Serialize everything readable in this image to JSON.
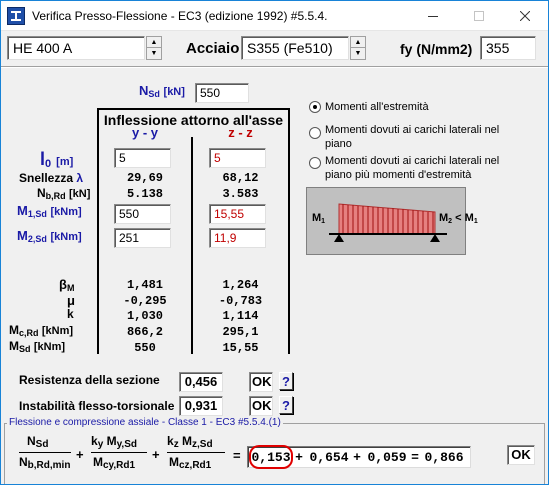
{
  "window": {
    "title": "Verifica Presso-Flessione - EC3 (edizione 1992) #5.5.4.",
    "icon": "app-i-beam-icon",
    "controls": [
      "minimize-icon",
      "maximize-icon",
      "close-icon"
    ]
  },
  "top": {
    "profile_value": "HE 400 A",
    "steel_label": "Acciaio",
    "steel_value": "S355 (Fe510)",
    "fy_label": "fy (N/mm2)",
    "fy_value": "355"
  },
  "nsd": {
    "label_main": "N",
    "label_sub": "Sd",
    "unit": "[kN]",
    "value": "550"
  },
  "table": {
    "header": "Inflessione attorno all'asse",
    "col_yy": "y - y",
    "col_zz": "z - z",
    "l0": {
      "label_main": "l",
      "label_sub": "0",
      "unit": "[m]",
      "yy": "5",
      "zz": "5"
    },
    "snellezza": {
      "label": "Snellezza",
      "symbol": "λ",
      "yy": "29,69",
      "zz": "68,12"
    },
    "nbrd": {
      "label_main": "N",
      "label_sub": "b,Rd",
      "unit": "[kN]",
      "yy": "5.138",
      "zz": "3.583"
    },
    "m1sd": {
      "label_main": "M",
      "label_sub": "1,Sd",
      "unit": "[kNm]",
      "yy": "550",
      "zz": "15,55"
    },
    "m2sd": {
      "label_main": "M",
      "label_sub": "2,Sd",
      "unit": "[kNm]",
      "yy": "251",
      "zz": "11,9"
    },
    "betam": {
      "label_main": "β",
      "label_sub": "M",
      "yy": "1,481",
      "zz": "1,264"
    },
    "mu": {
      "label": "μ",
      "yy": "-0,295",
      "zz": "-0,783"
    },
    "k": {
      "label": "k",
      "yy": "1,030",
      "zz": "1,114"
    },
    "mcrd": {
      "label_main": "M",
      "label_sub": "c,Rd",
      "unit": "[kNm]",
      "yy": "866,2",
      "zz": "295,1"
    },
    "msd": {
      "label_main": "M",
      "label_sub": "Sd",
      "unit": "[kNm]",
      "yy": "550",
      "zz": "15,55"
    }
  },
  "options": {
    "selected": 0,
    "items": [
      "Momenti all'estremità",
      "Momenti dovuti ai carichi laterali nel piano",
      "Momenti dovuti ai carichi laterali nel piano più momenti d'estremità"
    ]
  },
  "diagram": {
    "m1": "M",
    "m1_sub": "1",
    "m2": "M",
    "m2_sub": "2",
    "lt": "<",
    "m3": "M",
    "m3_sub": "1"
  },
  "checks": {
    "resistenza_label": "Resistenza della sezione",
    "resistenza_value": "0,456",
    "instabilita_label": "Instabilità flesso-torsionale",
    "instabilita_value": "0,931",
    "ok_label": "OK",
    "help_label": "?"
  },
  "formula": {
    "group_title": "Flessione e compressione assiale - Classe 1 - EC3 #5.5.4.(1)",
    "term1": "0,153",
    "plus": "+",
    "term2": "0,654",
    "term3": "0,059",
    "equals": "=",
    "result": "0,866",
    "ok_label": "OK",
    "f1_num_main": "N",
    "f1_num_sub": "Sd",
    "f1_den_main": "N",
    "f1_den_sub": "b,Rd,min",
    "f2_k": "k",
    "f2_k_sub": "y",
    "f2_num_main": "M",
    "f2_num_sub": "y,Sd",
    "f2_den_main": "M",
    "f2_den_sub": "cy,Rd1",
    "f3_k": "k",
    "f3_k_sub": "z",
    "f3_num_main": "M",
    "f3_num_sub": "z,Sd",
    "f3_den_main": "M",
    "f3_den_sub": "cz,Rd1"
  }
}
